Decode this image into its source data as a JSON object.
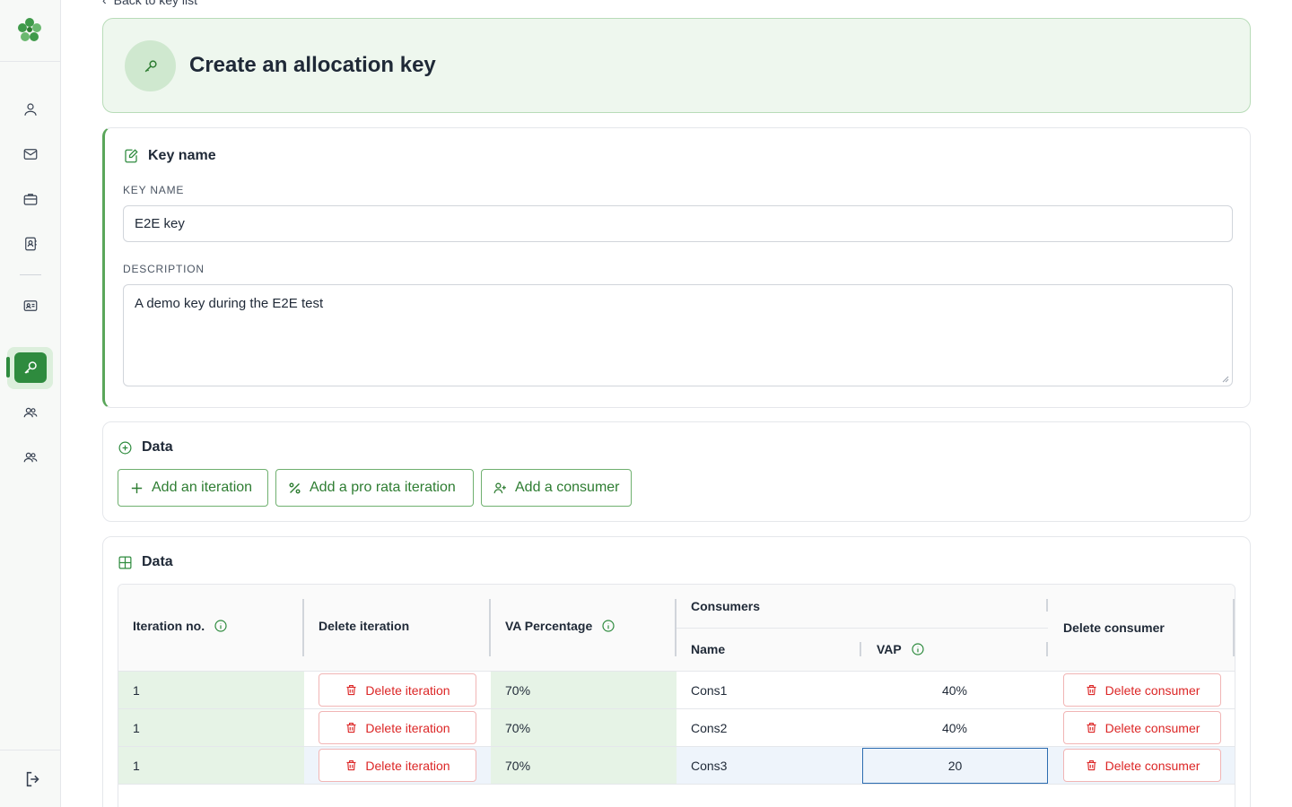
{
  "nav": {
    "back_label": "Back to key list",
    "logout_icon": "logout-icon",
    "items": [
      {
        "icon": "user-icon"
      },
      {
        "icon": "mail-icon"
      },
      {
        "icon": "briefcase-icon"
      },
      {
        "icon": "contact-book-icon"
      },
      {
        "icon": "id-card-icon"
      },
      {
        "icon": "key-icon",
        "active": true
      },
      {
        "icon": "users-icon"
      },
      {
        "icon": "users-group-icon"
      }
    ]
  },
  "header": {
    "title": "Create an allocation key"
  },
  "key_section": {
    "title": "Key name",
    "key_name_label": "KEY NAME",
    "key_name_value": "E2E key",
    "description_label": "DESCRIPTION",
    "description_value": "A demo key during the E2E test"
  },
  "actions_section": {
    "title": "Data",
    "add_iteration": "Add an iteration",
    "add_pro_rata": "Add a pro rata iteration",
    "add_consumer": "Add a consumer"
  },
  "table_section": {
    "title": "Data",
    "headers": {
      "iteration_no": "Iteration no.",
      "delete_iteration": "Delete iteration",
      "va_percentage": "VA Percentage",
      "consumers": "Consumers",
      "name": "Name",
      "vap": "VAP",
      "delete_consumer": "Delete consumer"
    },
    "rows": [
      {
        "iteration": "1",
        "delete_iteration": "Delete iteration",
        "va_percentage": "70%",
        "name": "Cons1",
        "vap": "40%",
        "delete_consumer": "Delete consumer"
      },
      {
        "iteration": "1",
        "delete_iteration": "Delete iteration",
        "va_percentage": "70%",
        "name": "Cons2",
        "vap": "40%",
        "delete_consumer": "Delete consumer"
      },
      {
        "iteration": "1",
        "delete_iteration": "Delete iteration",
        "va_percentage": "70%",
        "name": "Cons3",
        "vap": "20",
        "delete_consumer": "Delete consumer"
      }
    ]
  },
  "colors": {
    "accent": "#2e8b3e",
    "accent_light": "#eef7ee",
    "danger": "#dc2626",
    "focus": "#2b6cb0"
  }
}
